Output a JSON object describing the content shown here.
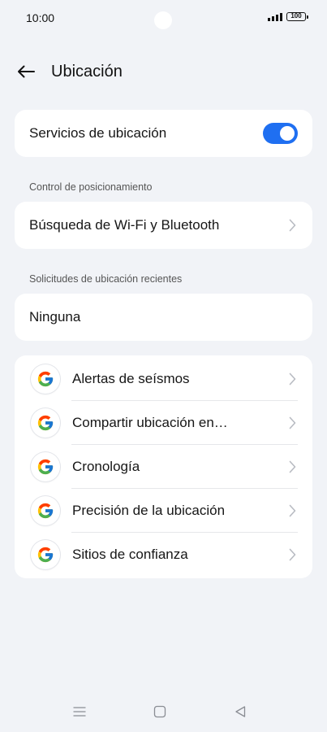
{
  "status_bar": {
    "time": "10:00",
    "battery": "100"
  },
  "header": {
    "title": "Ubicación"
  },
  "location_services": {
    "label": "Servicios de ubicación",
    "enabled": true
  },
  "positioning": {
    "section_title": "Control de posicionamiento",
    "item_label": "Búsqueda de Wi-Fi y Bluetooth"
  },
  "recent_requests": {
    "section_title": "Solicitudes de ubicación recientes",
    "item_label": "Ninguna"
  },
  "google_services": [
    {
      "label": "Alertas de seísmos",
      "icon": "google-g-icon"
    },
    {
      "label": "Compartir ubicación en…",
      "icon": "google-g-icon"
    },
    {
      "label": "Cronología",
      "icon": "google-g-icon"
    },
    {
      "label": "Precisión de la ubicación",
      "icon": "google-g-icon"
    },
    {
      "label": "Sitios de confianza",
      "icon": "google-g-icon"
    }
  ],
  "colors": {
    "accent": "#1f6ff1",
    "background": "#f1f3f7",
    "card": "#ffffff"
  }
}
